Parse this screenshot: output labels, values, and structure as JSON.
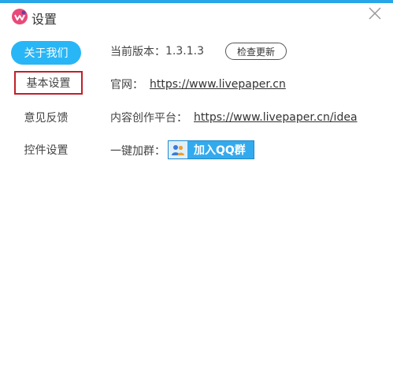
{
  "window": {
    "title": "设置"
  },
  "nav": {
    "items": [
      {
        "label": "关于我们"
      },
      {
        "label": "基本设置"
      },
      {
        "label": "意见反馈"
      },
      {
        "label": "控件设置"
      }
    ]
  },
  "about": {
    "version_label": "当前版本：",
    "version_value": "1.3.1.3",
    "check_update": "检查更新",
    "website_label": "官网：",
    "website_url": "https://www.livepaper.cn",
    "platform_label": "内容创作平台：",
    "platform_url": "https://www.livepaper.cn/idea",
    "group_label": "一键加群：",
    "qq_button": "加入QQ群"
  },
  "colors": {
    "accent": "#29b6f6",
    "highlight_border": "#c0202a"
  },
  "icons": {
    "app": "app-logo-icon",
    "close": "close-icon",
    "qq": "qq-group-icon"
  }
}
